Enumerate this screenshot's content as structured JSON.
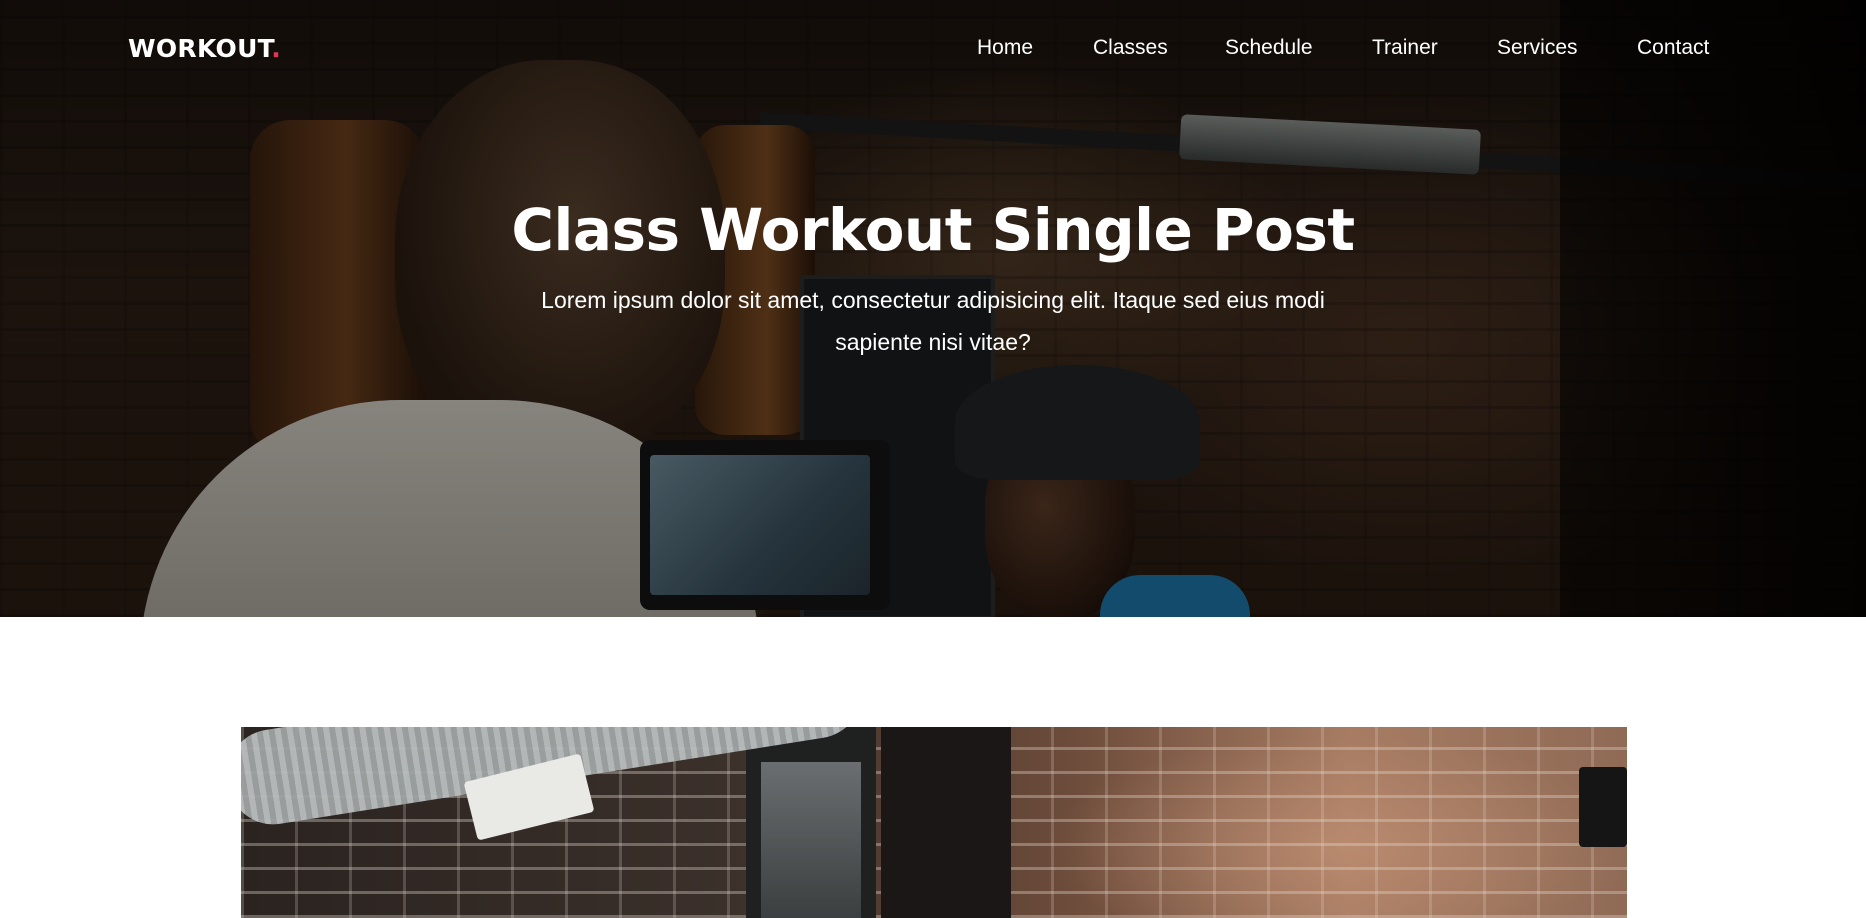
{
  "header": {
    "logo_text": "WORKOUT",
    "logo_dot": ".",
    "nav": [
      {
        "label": "Home"
      },
      {
        "label": "Classes"
      },
      {
        "label": "Schedule"
      },
      {
        "label": "Trainer"
      },
      {
        "label": "Services"
      },
      {
        "label": "Contact"
      }
    ]
  },
  "hero": {
    "title": "Class Workout Single Post",
    "subtitle": "Lorem ipsum dolor sit amet, consectetur adipisicing elit. Itaque sed eius modi sapiente nisi vitae?"
  },
  "colors": {
    "accent": "#e5345b",
    "text_light": "#ffffff",
    "page_background": "#ffffff"
  }
}
